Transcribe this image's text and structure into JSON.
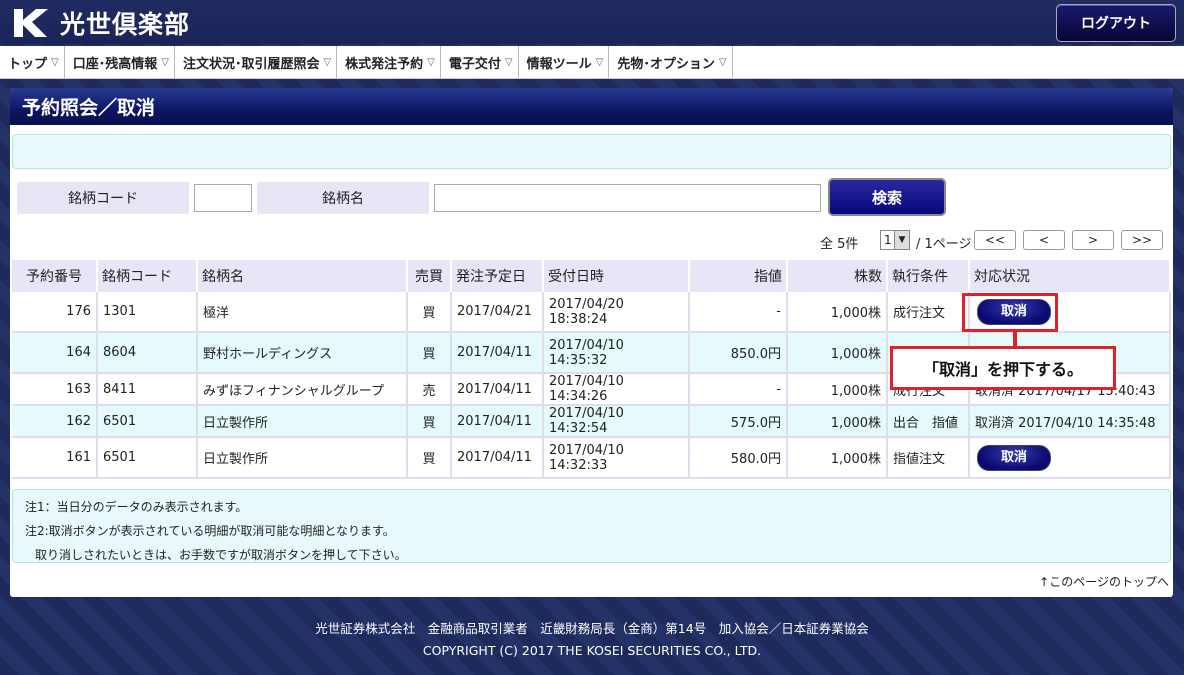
{
  "header": {
    "logo_text": "光世倶楽部",
    "logout_label": "ログアウト"
  },
  "nav": {
    "items": [
      {
        "label": "トップ"
      },
      {
        "label": "口座･残高情報"
      },
      {
        "label": "注文状況･取引履歴照会"
      },
      {
        "label": "株式発注予約"
      },
      {
        "label": "電子交付"
      },
      {
        "label": "情報ツール"
      },
      {
        "label": "先物･オプション"
      }
    ]
  },
  "page_title": "予約照会／取消",
  "search": {
    "code_label": "銘柄コード",
    "name_label": "銘柄名",
    "code_value": "",
    "name_value": "",
    "button_label": "検索"
  },
  "pager": {
    "count": "全 5件",
    "page_select": "1",
    "total_pages": "/ 1ページ",
    "first": "<<",
    "prev": "<",
    "next": ">",
    "last": ">>"
  },
  "table": {
    "headers": [
      "予約番号",
      "銘柄コード",
      "銘柄名",
      "売買",
      "発注予定日",
      "受付日時",
      "指値",
      "株数",
      "執行条件",
      "対応状況"
    ],
    "rows": [
      {
        "no": "176",
        "code": "1301",
        "name": "極洋",
        "side": "買",
        "date": "2017/04/21",
        "received": "2017/04/20 18:38:24",
        "limit": "-",
        "qty": "1,000株",
        "cond": "成行注文",
        "status": "取消"
      },
      {
        "no": "164",
        "code": "8604",
        "name": "野村ホールディングス",
        "side": "買",
        "date": "2017/04/11",
        "received": "2017/04/10 14:35:32",
        "limit": "850.0円",
        "qty": "1,000株",
        "cond": "",
        "status": ""
      },
      {
        "no": "163",
        "code": "8411",
        "name": "みずほフィナンシャルグループ",
        "side": "売",
        "date": "2017/04/11",
        "received": "2017/04/10 14:34:26",
        "limit": "-",
        "qty": "1,000株",
        "cond": "成行注文",
        "status": "取消済 2017/04/17 15:40:43"
      },
      {
        "no": "162",
        "code": "6501",
        "name": "日立製作所",
        "side": "買",
        "date": "2017/04/11",
        "received": "2017/04/10 14:32:54",
        "limit": "575.0円",
        "qty": "1,000株",
        "cond": "出合　指値",
        "status": "取消済 2017/04/10 14:35:48"
      },
      {
        "no": "161",
        "code": "6501",
        "name": "日立製作所",
        "side": "買",
        "date": "2017/04/11",
        "received": "2017/04/10 14:32:33",
        "limit": "580.0円",
        "qty": "1,000株",
        "cond": "指値注文",
        "status": "取消"
      }
    ]
  },
  "notes": {
    "note1": "注1：当日分のデータのみ表示されます。",
    "note2": "注2:取消ボタンが表示されている明細が取消可能な明細となります。",
    "note3": "取り消しされたいときは、お手数ですが取消ボタンを押して下さい。"
  },
  "top_link": "↑このページのトップへ",
  "callout_text": "「取消」を押下する。",
  "footer": {
    "line1": "光世証券株式会社　金融商品取引業者　近畿財務局長（金商）第14号　加入協会／日本証券業協会",
    "line2": "COPYRIGHT (C) 2017 THE KOSEI SECURITIES CO., LTD."
  },
  "colors": {
    "navy": "#0c1664",
    "accent_red": "#e0202a",
    "light_cyan": "#e6fafc"
  }
}
